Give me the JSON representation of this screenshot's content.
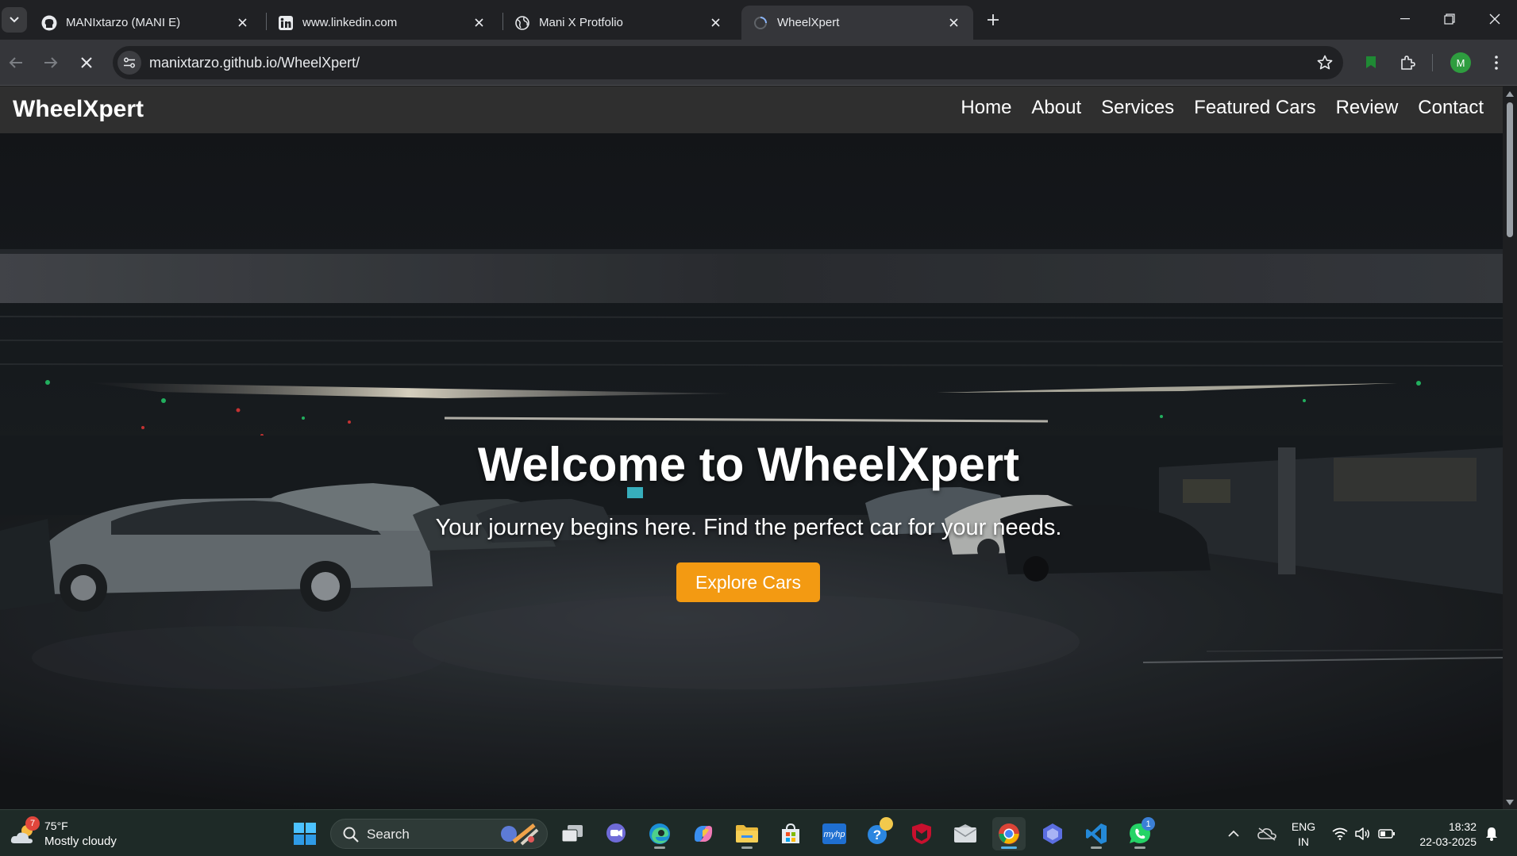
{
  "browser": {
    "tabs": [
      {
        "title": "MANIxtarzo (MANI E)",
        "icon": "github-icon"
      },
      {
        "title": "www.linkedin.com",
        "icon": "linkedin-icon"
      },
      {
        "title": "Mani X Protfolio",
        "icon": "globe-icon"
      },
      {
        "title": "WheelXpert",
        "icon": "loading-icon",
        "active": true
      }
    ],
    "url": "manixtarzo.github.io/WheelXpert/",
    "profile_initial": "M"
  },
  "site": {
    "brand": "WheelXpert",
    "nav": [
      "Home",
      "About",
      "Services",
      "Featured Cars",
      "Review",
      "Contact"
    ],
    "hero": {
      "title": "Welcome to WheelXpert",
      "subtitle": "Your journey begins here. Find the perfect car for your needs.",
      "cta": "Explore Cars"
    },
    "colors": {
      "nav_bg": "#2f2f2f",
      "accent": "#f39a12"
    }
  },
  "taskbar": {
    "weather": {
      "temp": "75°F",
      "desc": "Mostly cloudy",
      "badge": "7"
    },
    "search_label": "Search",
    "whatsapp_badge": "1",
    "lang_line1": "ENG",
    "lang_line2": "IN",
    "time": "18:32",
    "date": "22-03-2025"
  }
}
